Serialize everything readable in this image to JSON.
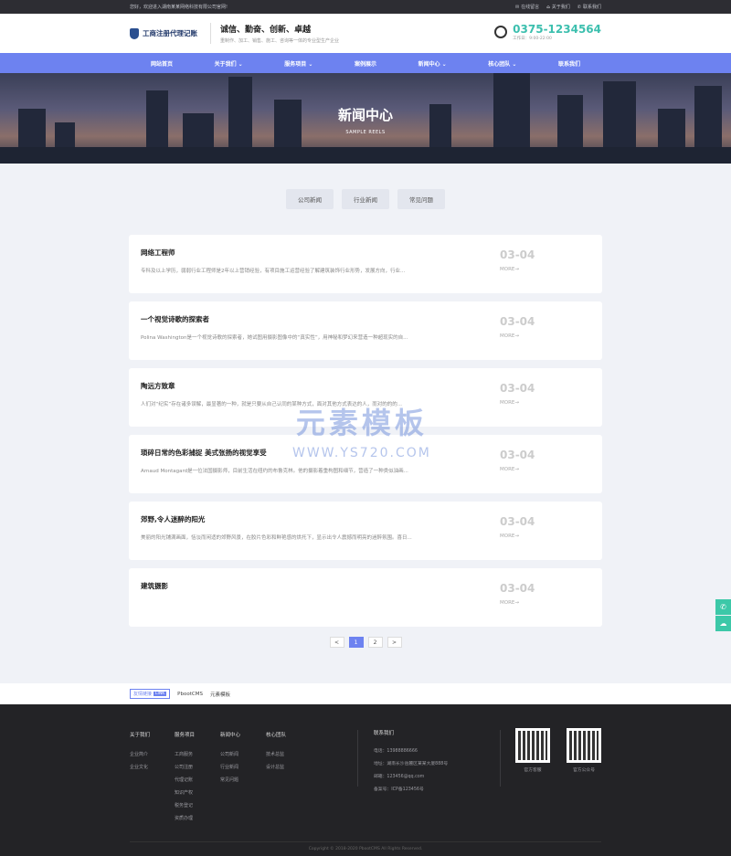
{
  "topbar": {
    "welcome": "您好，欢迎进入湖南某某网络科技有限公司官网!",
    "links": [
      "在线留言",
      "关于我们",
      "联系我们"
    ]
  },
  "header": {
    "logo": "工商注册代理记账",
    "slogan": "诚信、勤奋、创新、卓越",
    "subslogan": "重制作、加工、销售、施工、咨询等一体的专业型生产企业",
    "phone": "0375-1234564",
    "hours": "工作日：9:00-22:00"
  },
  "nav": [
    "网站首页",
    "关于我们",
    "服务项目",
    "案例展示",
    "新闻中心",
    "核心团队",
    "联系我们"
  ],
  "banner": {
    "title": "新闻中心",
    "subtitle": "SAMPLE REELS"
  },
  "tabs": [
    "公司新闻",
    "行业新闻",
    "常见问题"
  ],
  "news": [
    {
      "title": "网络工程师",
      "desc": "专科及以上学历，弱弱行业工程师是2年以上营销经验，有项目施工运营经验了解建筑装饰行业形势，发展方向，行业...",
      "date": "03-04",
      "more": "MORE→"
    },
    {
      "title": "一个视觉诗歌的探索者",
      "desc": "Polina Washington是一个视觉诗歌的探索者，她试图用摄影图像中的“真实性”，用神秘和梦幻来营造一种超现实的自...",
      "date": "03-04",
      "more": "MORE→"
    },
    {
      "title": "陶远方致章",
      "desc": "人们对“纪实”存在诸多误解，最显著的一种，就是只要从自己认同的某种方式，面对其他方式表达的人，而对的的的...",
      "date": "03-04",
      "more": "MORE→"
    },
    {
      "title": "琐碎日常的色彩捕捉 美式张扬的视觉享受",
      "desc": "Arnaud Montagard是一位法国摄影师，目前生活在纽约的布鲁克林。他的摄影着重构图和细节，营造了一种类似油画...",
      "date": "03-04",
      "more": "MORE→"
    },
    {
      "title": "郊野,令人迷醉的阳光",
      "desc": "美丽的阳光铺满画面，恬淡而闲适的郊野风景，在胶片色彩和鲜艳感的烘托下，显示出令人震撼而明亮的迷醉氛围。喜日...",
      "date": "03-04",
      "more": "MORE→"
    },
    {
      "title": "建筑摄影",
      "desc": "",
      "date": "03-04",
      "more": "MORE→"
    }
  ],
  "pager": {
    "prev": "<",
    "pages": [
      "1",
      "2"
    ],
    "next": ">"
  },
  "links": {
    "label": "友情链接",
    "link_tag": "LINK",
    "items": [
      "PbootCMS",
      "元素模板"
    ]
  },
  "footer": {
    "cols": [
      {
        "title": "关于我们",
        "items": [
          "企业简介",
          "企业文化"
        ]
      },
      {
        "title": "服务项目",
        "items": [
          "工商服务",
          "公司注册",
          "代理记账",
          "知识产权",
          "税务登记",
          "资质办理"
        ]
      },
      {
        "title": "新闻中心",
        "items": [
          "公司新闻",
          "行业新闻",
          "常见问题"
        ]
      },
      {
        "title": "核心团队",
        "items": [
          "技术总监",
          "设计总监"
        ]
      }
    ],
    "contact": {
      "title": "联系我们",
      "items": [
        "电话：13988886666",
        "地址：湖南长沙岳麓区某某大厦888号",
        "邮箱：123456@qq.com",
        "备案号：ICP备123456号"
      ]
    },
    "qr": [
      "官方客服",
      "官方公众号"
    ],
    "copyright": "Copyright © 2018-2020 PbootCMS All Rights Reserved."
  },
  "watermark": {
    "line1": "元素模板",
    "line2": "WWW.YS720.COM"
  }
}
